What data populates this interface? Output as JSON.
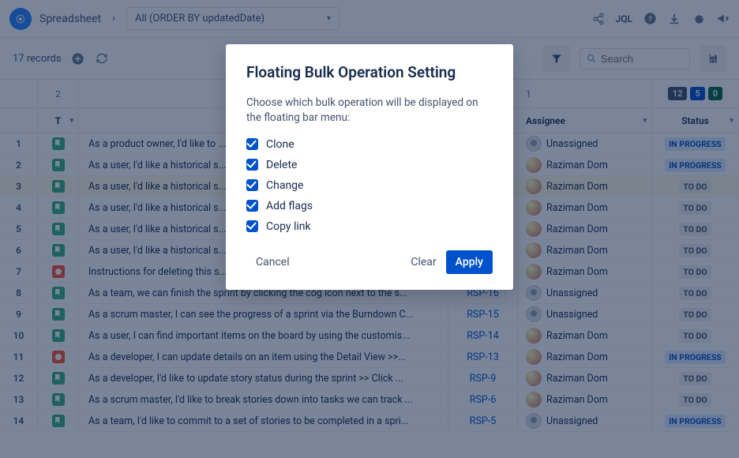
{
  "topbar": {
    "app_name": "Spreadsheet",
    "filter_label": "All (ORDER BY updatedDate)",
    "jql_label": "JQL"
  },
  "toolbar": {
    "records_label": "17 records",
    "search_placeholder": "Search"
  },
  "columns": {
    "type_group": "2",
    "assignee_group": "1",
    "type_label": "T",
    "summary_label": "",
    "key_label": "",
    "assignee_label": "Assignee",
    "status_label": "Status",
    "badges": {
      "dark": "12",
      "blue": "5",
      "green": "0"
    }
  },
  "rows": [
    {
      "n": "1",
      "type": "story",
      "summary": "As a product owner, I'd like to ...",
      "key": "",
      "assignee": "Unassigned",
      "assignee_kind": "unassigned",
      "status": "IN PROGRESS",
      "status_kind": "progress"
    },
    {
      "n": "2",
      "type": "story",
      "summary": "As a user, I'd like a historical s...",
      "key": "",
      "assignee": "Raziman Dom",
      "assignee_kind": "user",
      "status": "IN PROGRESS",
      "status_kind": "progress"
    },
    {
      "n": "3",
      "type": "story",
      "summary": "As a user, I'd like a historical s...",
      "key": "",
      "assignee": "Raziman Dom",
      "assignee_kind": "user",
      "status": "TO DO",
      "status_kind": "todo",
      "highlight": true
    },
    {
      "n": "4",
      "type": "story",
      "summary": "As a user, I'd like a historical s...",
      "key": "",
      "assignee": "Raziman Dom",
      "assignee_kind": "user",
      "status": "TO DO",
      "status_kind": "todo"
    },
    {
      "n": "5",
      "type": "story",
      "summary": "As a user, I'd like a historical s...",
      "key": "",
      "assignee": "Raziman Dom",
      "assignee_kind": "user",
      "status": "TO DO",
      "status_kind": "todo"
    },
    {
      "n": "6",
      "type": "story",
      "summary": "As a user, I'd like a historical s...",
      "key": "",
      "assignee": "Raziman Dom",
      "assignee_kind": "user",
      "status": "TO DO",
      "status_kind": "todo"
    },
    {
      "n": "7",
      "type": "bug",
      "summary": "Instructions for deleting this s...",
      "key": "",
      "assignee": "Raziman Dom",
      "assignee_kind": "user",
      "status": "TO DO",
      "status_kind": "todo"
    },
    {
      "n": "8",
      "type": "story",
      "summary": "As a team, we can finish the sprint by clicking the cog icon next to the s...",
      "key": "RSP-16",
      "assignee": "Unassigned",
      "assignee_kind": "unassigned",
      "status": "TO DO",
      "status_kind": "todo"
    },
    {
      "n": "9",
      "type": "story",
      "summary": "As a scrum master, I can see the progress of a sprint via the Burndown C...",
      "key": "RSP-15",
      "assignee": "Unassigned",
      "assignee_kind": "unassigned",
      "status": "TO DO",
      "status_kind": "todo"
    },
    {
      "n": "10",
      "type": "story",
      "summary": "As a user, I can find important items on the board by using the customis...",
      "key": "RSP-14",
      "assignee": "Raziman Dom",
      "assignee_kind": "user",
      "status": "TO DO",
      "status_kind": "todo"
    },
    {
      "n": "11",
      "type": "bug",
      "summary": "As a developer, I can update details on an item using the Detail View >>...",
      "key": "RSP-13",
      "assignee": "Raziman Dom",
      "assignee_kind": "user",
      "status": "IN PROGRESS",
      "status_kind": "progress"
    },
    {
      "n": "12",
      "type": "story",
      "summary": "As a developer, I'd like to update story status during the sprint >> Click ...",
      "key": "RSP-9",
      "assignee": "Raziman Dom",
      "assignee_kind": "user",
      "status": "TO DO",
      "status_kind": "todo"
    },
    {
      "n": "13",
      "type": "story",
      "summary": "As a scrum master, I'd like to break stories down into tasks we can track ...",
      "key": "RSP-6",
      "assignee": "Raziman Dom",
      "assignee_kind": "user",
      "status": "TO DO",
      "status_kind": "todo"
    },
    {
      "n": "14",
      "type": "story",
      "summary": "As a team, I'd like to commit to a set of stories to be completed in a spri...",
      "key": "RSP-5",
      "assignee": "Unassigned",
      "assignee_kind": "unassigned",
      "status": "IN PROGRESS",
      "status_kind": "progress"
    }
  ],
  "modal": {
    "title": "Floating Bulk Operation Setting",
    "description": "Choose which bulk operation will be displayed on the floating bar menu:",
    "options": [
      {
        "label": "Clone",
        "checked": true
      },
      {
        "label": "Delete",
        "checked": true
      },
      {
        "label": "Change",
        "checked": true
      },
      {
        "label": "Add flags",
        "checked": true
      },
      {
        "label": "Copy link",
        "checked": true
      }
    ],
    "cancel_label": "Cancel",
    "clear_label": "Clear",
    "apply_label": "Apply"
  }
}
